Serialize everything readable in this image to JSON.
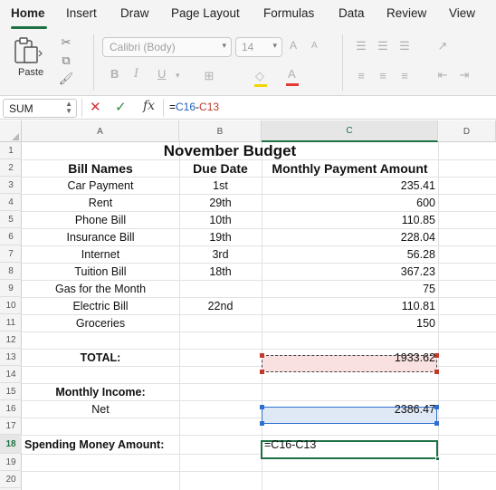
{
  "ribbon_tabs": [
    "Home",
    "Insert",
    "Draw",
    "Page Layout",
    "Formulas",
    "Data",
    "Review",
    "View"
  ],
  "ribbon": {
    "paste_label": "Paste",
    "font_name": "Calibri (Body)",
    "font_size": "14",
    "bold": "B",
    "italic": "I",
    "underline": "U",
    "grow_font": "A",
    "shrink_font": "A",
    "font_color": "A"
  },
  "formula_bar": {
    "name_box": "SUM",
    "fx": "fx",
    "formula_eq": "=",
    "ref1": "C16",
    "minus": "-",
    "ref2": "C13"
  },
  "columns": [
    "A",
    "B",
    "C",
    "D"
  ],
  "rows": [
    "1",
    "2",
    "3",
    "4",
    "5",
    "6",
    "7",
    "8",
    "9",
    "10",
    "11",
    "12",
    "13",
    "14",
    "15",
    "16",
    "17",
    "18",
    "19",
    "20"
  ],
  "sheet": {
    "title": "November Budget",
    "headers": {
      "bill": "Bill Names",
      "due": "Due Date",
      "amount": "Monthly Payment Amount"
    },
    "bills": [
      {
        "name": "Car Payment",
        "due": "1st",
        "amount": "235.41"
      },
      {
        "name": "Rent",
        "due": "29th",
        "amount": "600"
      },
      {
        "name": "Phone Bill",
        "due": "10th",
        "amount": "110.85"
      },
      {
        "name": "Insurance Bill",
        "due": "19th",
        "amount": "228.04"
      },
      {
        "name": "Internet",
        "due": "3rd",
        "amount": "56.28"
      },
      {
        "name": "Tuition Bill",
        "due": "18th",
        "amount": "367.23"
      },
      {
        "name": "Gas for the Month",
        "due": "",
        "amount": "75"
      },
      {
        "name": "Electric Bill",
        "due": "22nd",
        "amount": "110.81"
      },
      {
        "name": "Groceries",
        "due": "",
        "amount": "150"
      }
    ],
    "total_label": "TOTAL:",
    "total_value": "1933.62",
    "income_label": "Monthly Income:",
    "net_label": "Net",
    "net_value": "2386.47",
    "spending_label": "Spending Money Amount:",
    "spending_formula": "=C16-C13"
  },
  "colors": {
    "accent": "#1e7145",
    "ref_blue": "#2f6fd1",
    "ref_red": "#c0392b"
  }
}
